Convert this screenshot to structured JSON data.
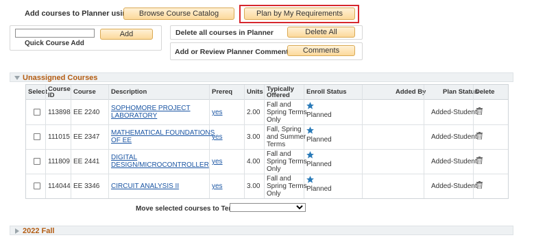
{
  "planner": {
    "add_courses_label": "Add courses to Planner using",
    "browse_catalog_label": "Browse Course Catalog",
    "plan_by_requirements_label": "Plan by My Requirements",
    "add_button_label": "Add",
    "quick_course_add_label": "Quick Course Add",
    "quick_course_value": "",
    "delete_all_text": "Delete all courses in Planner",
    "delete_all_button_label": "Delete All",
    "comments_text": "Add or Review Planner Comments",
    "comments_button_label": "Comments"
  },
  "unassigned": {
    "title": "Unassigned Courses",
    "columns": {
      "select": "Select",
      "course_id_line1": "Course",
      "course_id_line2": "ID",
      "course": "Course",
      "description": "Description",
      "prereq": "Prereq",
      "units": "Units",
      "typically_line1": "Typically",
      "typically_line2": "Offered",
      "enroll_status": "Enroll Status",
      "added_by": "Added By",
      "plan_status": "Plan Status",
      "delete": "Delete"
    },
    "rows": [
      {
        "course_id": "113898",
        "course": "EE 2240",
        "desc1": "SOPHOMORE PROJECT",
        "desc2": "LABORATORY",
        "prereq": "yes",
        "units": "2.00",
        "off1": "Fall and",
        "off2": "Spring Terms",
        "off3": "Only",
        "enroll_status": "Planned",
        "added_by": "",
        "plan_status": "Added-Student"
      },
      {
        "course_id": "111015",
        "course": "EE 2347",
        "desc1": "MATHEMATICAL FOUNDATIONS",
        "desc2": "OF EE",
        "prereq": "yes",
        "units": "3.00",
        "off1": "Fall, Spring",
        "off2": "and Summer",
        "off3": "Terms",
        "enroll_status": "Planned",
        "added_by": "",
        "plan_status": "Added-Student"
      },
      {
        "course_id": "111809",
        "course": "EE 2441",
        "desc1": "DIGITAL",
        "desc2": "DESIGN/MICROCONTROLLER",
        "prereq": "yes",
        "units": "4.00",
        "off1": "Fall and",
        "off2": "Spring Terms",
        "off3": "Only",
        "enroll_status": "Planned",
        "added_by": "",
        "plan_status": "Added-Student"
      },
      {
        "course_id": "114044",
        "course": "EE 3346",
        "desc1": "CIRCUIT ANALYSIS II",
        "desc2": "",
        "prereq": "yes",
        "units": "3.00",
        "off1": "Fall and",
        "off2": "Spring Terms",
        "off3": "Only",
        "enroll_status": "Planned",
        "added_by": "",
        "plan_status": "Added-Student"
      }
    ],
    "move_label": "Move selected courses to Term",
    "term_selected": ""
  },
  "term_section": {
    "title": "2022 Fall"
  },
  "colors": {
    "accent_orange": "#b35c12",
    "link_blue": "#1a55a3",
    "highlight_red": "#d6262d",
    "star_blue": "#2a7ab8"
  },
  "icons": {
    "enroll_status": "star-icon",
    "delete": "trash-icon"
  }
}
